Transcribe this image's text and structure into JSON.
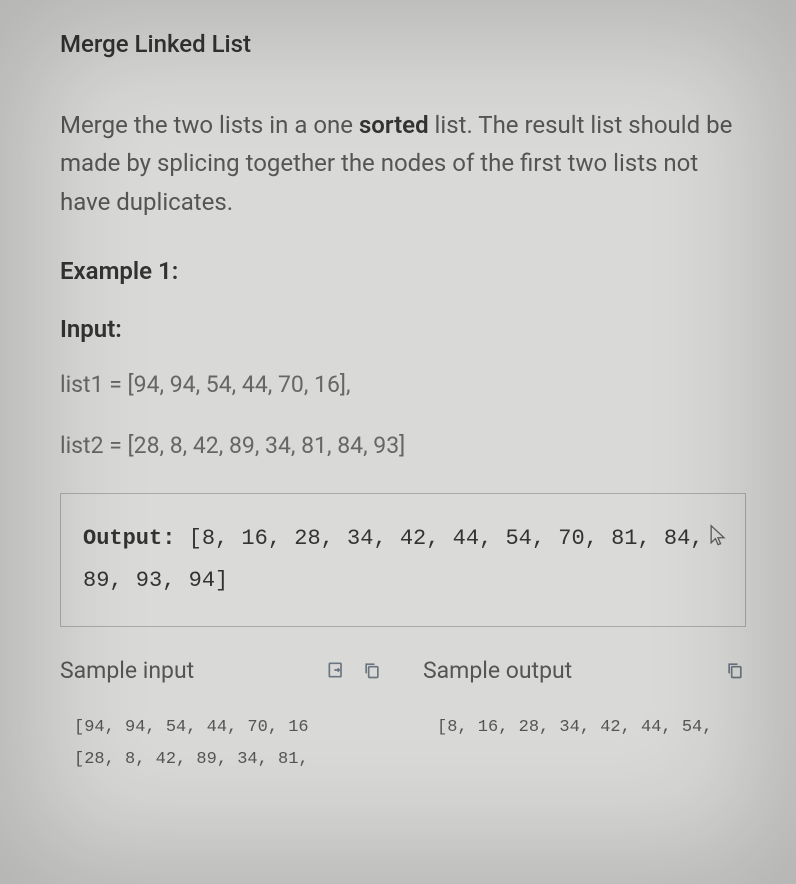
{
  "title": "Merge Linked List",
  "description_pre": "Merge the two lists in a one ",
  "description_bold": "sorted",
  "description_post": " list. The result list should be made by splicing together the nodes of the first two lists not have duplicates.",
  "example_label": "Example 1:",
  "input_label": "Input:",
  "list1": "list1 = [94, 94, 54, 44, 70, 16],",
  "list2": "list2 = [28, 8, 42, 89, 34, 81, 84, 93]",
  "output_label": "Output:",
  "output_value": " [8, 16, 28, 34, 42, 44, 54, 70, 81, 84, 89, 93, 94]",
  "sample_input_label": "Sample input",
  "sample_output_label": "Sample output",
  "sample_input_line1": "[94, 94, 54, 44, 70, 16",
  "sample_input_line2": "[28, 8, 42, 89, 34, 81,",
  "sample_output_line1": "[8, 16, 28, 34, 42, 44, 54,"
}
